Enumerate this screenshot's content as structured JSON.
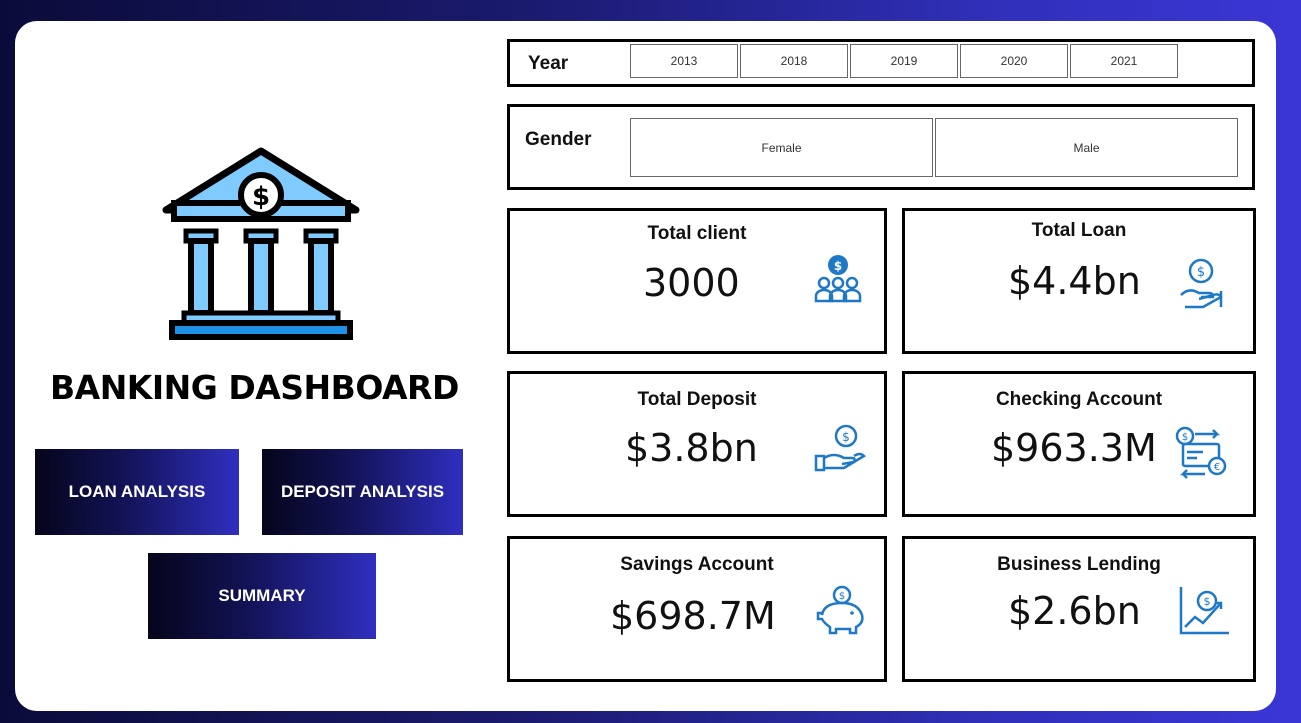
{
  "sidebar": {
    "title": "BANKING DASHBOARD",
    "buttons": {
      "loan": "LOAN ANALYSIS",
      "deposit": "DEPOSIT ANALYSIS",
      "summary": "SUMMARY"
    }
  },
  "filters": {
    "year": {
      "label": "Year",
      "options": [
        "2013",
        "2018",
        "2019",
        "2020",
        "2021"
      ]
    },
    "gender": {
      "label": "Gender",
      "options": [
        "Female",
        "Male"
      ]
    }
  },
  "kpis": [
    {
      "label": "Total client",
      "value": "3000",
      "icon": "clients-icon"
    },
    {
      "label": "Total Loan",
      "value": "$4.4bn",
      "icon": "loan-hand-coin-icon"
    },
    {
      "label": "Total Deposit",
      "value": "$3.8bn",
      "icon": "deposit-hand-coin-icon"
    },
    {
      "label": "Checking Account",
      "value": "$963.3M",
      "icon": "checking-exchange-icon"
    },
    {
      "label": "Savings Account",
      "value": "$698.7M",
      "icon": "piggy-bank-icon"
    },
    {
      "label": "Business Lending",
      "value": "$2.6bn",
      "icon": "growth-chart-icon"
    }
  ],
  "colors": {
    "accent_blue": "#2f2fc0",
    "icon_blue": "#1e78c8",
    "logo_light_blue": "#7fcbff",
    "background_dark": "#0b0b3a"
  }
}
